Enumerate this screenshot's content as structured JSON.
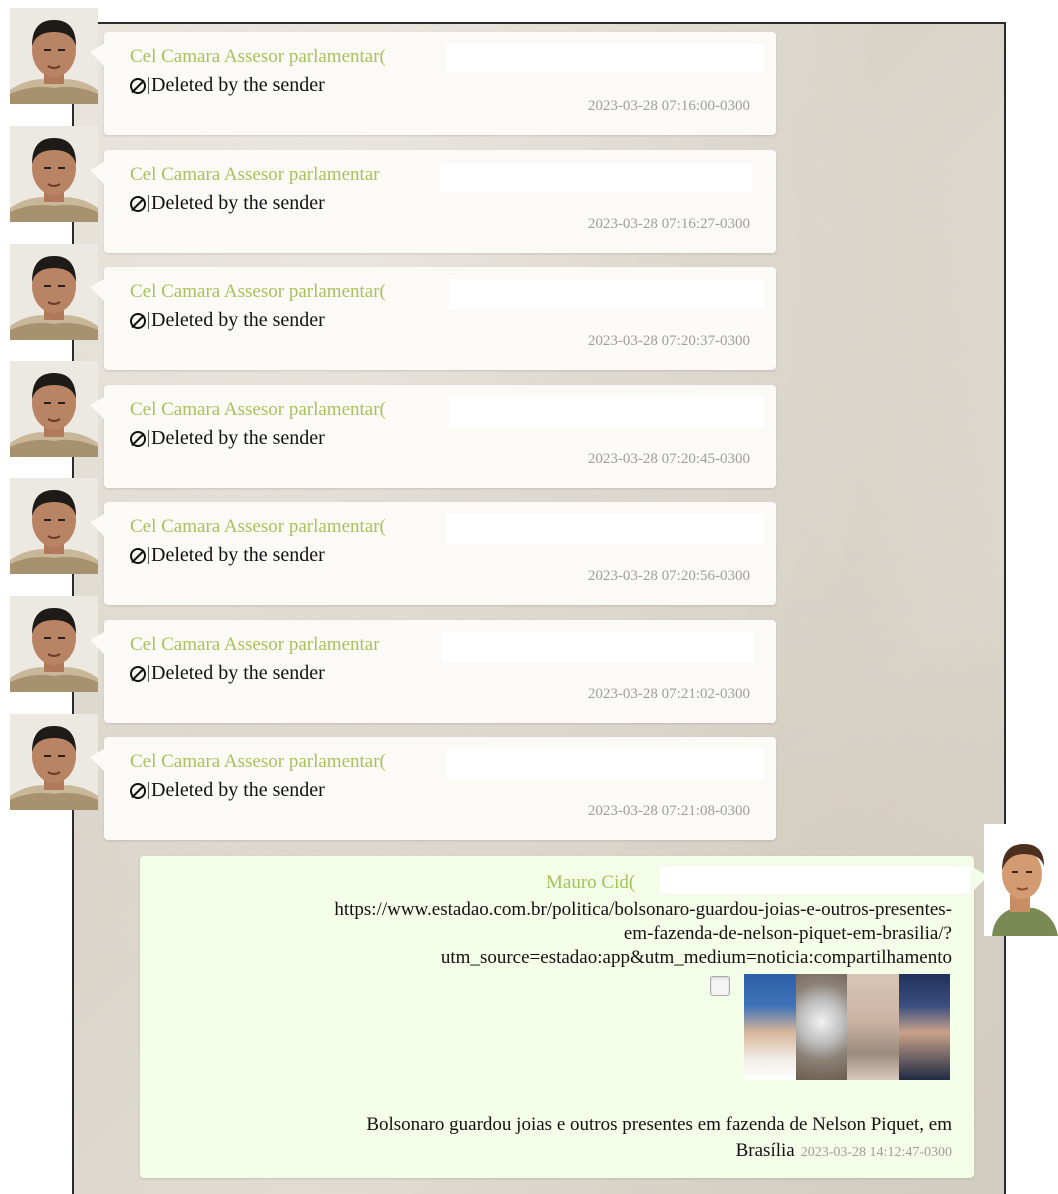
{
  "messages": [
    {
      "sender": "Cel Camara Assesor parlamentar(",
      "text": "Deleted by the sender",
      "time": "2023-03-28 07:16:00-0300"
    },
    {
      "sender": "Cel Camara Assesor parlamentar",
      "text": "Deleted by the sender",
      "time": "2023-03-28 07:16:27-0300"
    },
    {
      "sender": "Cel Camara Assesor parlamentar(",
      "text": "Deleted by the sender",
      "time": "2023-03-28 07:20:37-0300"
    },
    {
      "sender": "Cel Camara Assesor parlamentar(",
      "text": "Deleted by the sender",
      "time": "2023-03-28 07:20:45-0300"
    },
    {
      "sender": "Cel Camara Assesor parlamentar(",
      "text": "Deleted by the sender",
      "time": "2023-03-28 07:20:56-0300"
    },
    {
      "sender": "Cel Camara Assesor parlamentar",
      "text": "Deleted by the sender",
      "time": "2023-03-28 07:21:02-0300"
    },
    {
      "sender": "Cel Camara Assesor parlamentar(",
      "text": "Deleted by the sender",
      "time": "2023-03-28 07:21:08-0300"
    }
  ],
  "outgoing": {
    "sender": "Mauro Cid(",
    "url_line1": "https://www.estadao.com.br/politica/bolsonaro-guardou-joias-e-outros-presentes-",
    "url_line2": "em-fazenda-de-nelson-piquet-em-brasilia/?",
    "url_line3": "utm_source=estadao:app&utm_medium=noticia:compartilhamento",
    "caption_line1": "Bolsonaro guardou joias e outros presentes em fazenda de Nelson Piquet, em",
    "caption_line2": "Brasília",
    "time": "2023-03-28 14:12:47-0300"
  },
  "icons": {
    "deleted": "ban-icon",
    "avatar_in": "avatar-person-icon",
    "avatar_out": "avatar-person-icon",
    "preview": "link-preview-thumbnail"
  },
  "colors": {
    "sender_name": "#a8c25a",
    "incoming_bubble": "#fbfaf7",
    "outgoing_bubble": "#f3fde8",
    "timestamp": "#a19e98"
  }
}
